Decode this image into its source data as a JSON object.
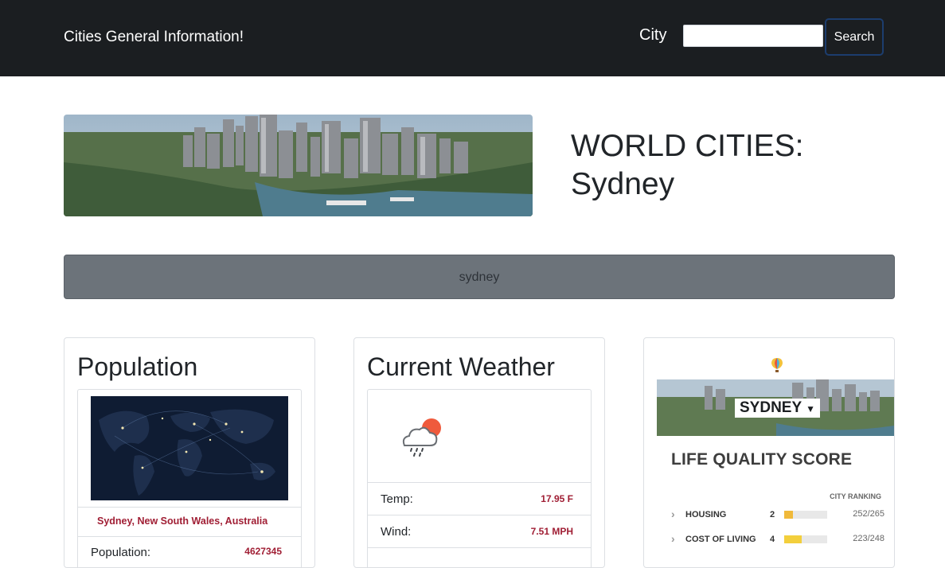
{
  "navbar": {
    "brand": "Cities General Information!",
    "city_label": "City",
    "city_input_value": "",
    "search_label": "Search"
  },
  "hero": {
    "title_line1": "WORLD CITIES:",
    "title_line2": "Sydney"
  },
  "city_bar": {
    "text": "sydney"
  },
  "population": {
    "title": "Population",
    "location": "Sydney, New South Wales, Australia",
    "label": "Population:",
    "value": "4627345"
  },
  "weather": {
    "title": "Current Weather",
    "icon": "rain-cloud-sun-icon",
    "rows": [
      {
        "label": "Temp:",
        "value": "17.95 F"
      },
      {
        "label": "Wind:",
        "value": "7.51 MPH"
      }
    ]
  },
  "life_quality": {
    "city_tag": "SYDNEY",
    "title": "LIFE QUALITY SCORE",
    "ranking_header": "CITY RANKING",
    "rows": [
      {
        "label": "HOUSING",
        "score": "2",
        "score_fraction": 0.2,
        "color": "#f0b93a",
        "rank": "252/265"
      },
      {
        "label": "COST OF LIVING",
        "score": "4",
        "score_fraction": 0.4,
        "color": "#f3cf3c",
        "rank": "223/248"
      }
    ]
  }
}
